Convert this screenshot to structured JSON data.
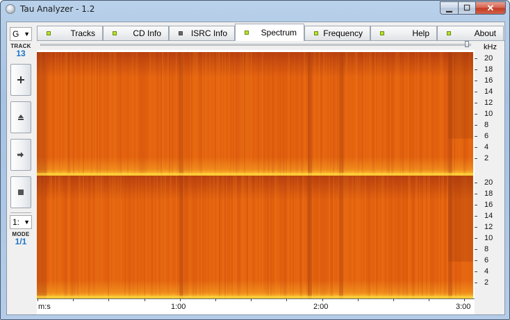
{
  "window": {
    "title": "Tau Analyzer - 1.2"
  },
  "left_panel": {
    "drive": "G",
    "track_label": "TRACK",
    "track_number": "13",
    "mode_select": "1:",
    "mode_label": "MODE",
    "mode_value": "1/1",
    "buttons": [
      "plus-icon",
      "eject-icon",
      "play-icon",
      "stop-icon"
    ]
  },
  "tabs": [
    {
      "label": "Tracks",
      "led": "on",
      "active": false
    },
    {
      "label": "CD Info",
      "led": "on",
      "active": false
    },
    {
      "label": "ISRC Info",
      "led": "off",
      "active": false
    },
    {
      "label": "Spectrum",
      "led": "on",
      "active": true
    },
    {
      "label": "Frequency",
      "led": "on",
      "active": false
    },
    {
      "label": "Help",
      "led": "on",
      "active": false
    },
    {
      "label": "About",
      "led": "on",
      "active": false
    }
  ],
  "spectrum": {
    "freq_unit": "kHz",
    "freq_ticks": [
      "20",
      "18",
      "16",
      "14",
      "12",
      "10",
      "8",
      "6",
      "4",
      "2"
    ],
    "time_unit": "m:s",
    "time_labels": [
      "1:00",
      "2:00",
      "3:00"
    ],
    "colors": {
      "base": "#e4620f",
      "dark": "#b8400f",
      "bright": "#f08a1c",
      "low": "#ffd23a"
    }
  }
}
